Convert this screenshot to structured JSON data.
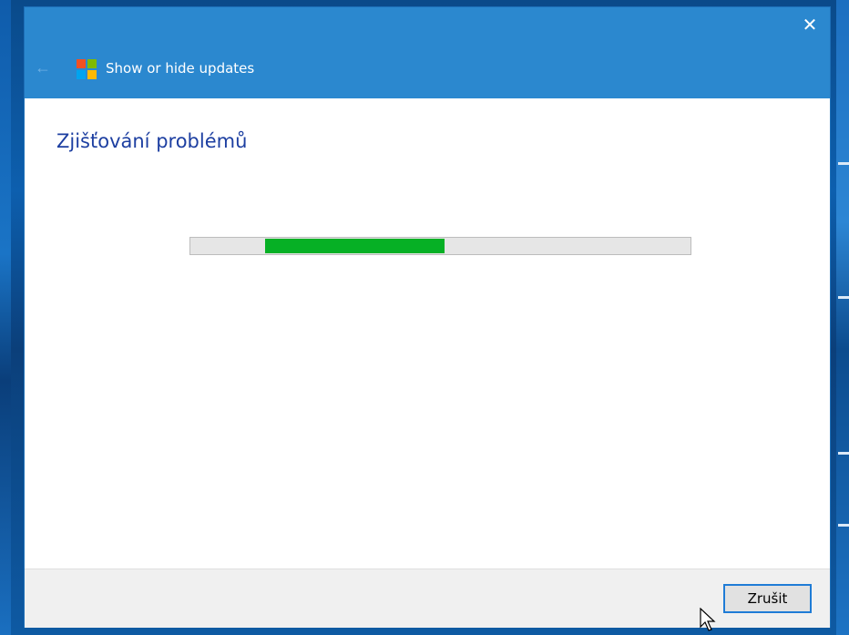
{
  "window": {
    "title": "Show or hide updates",
    "close_icon": "✕",
    "back_icon": "←"
  },
  "main": {
    "heading": "Zjišťování problémů",
    "progress": {
      "state": "indeterminate",
      "fill_color": "#06b025"
    }
  },
  "footer": {
    "cancel_label": "Zrušit"
  },
  "colors": {
    "titlebar": "#2b88cf",
    "heading": "#1d3fa1",
    "button_focus_border": "#1f7cd6"
  },
  "icons": [
    "close-icon",
    "back-arrow-icon",
    "windows-logo-icon",
    "mouse-cursor-icon"
  ]
}
